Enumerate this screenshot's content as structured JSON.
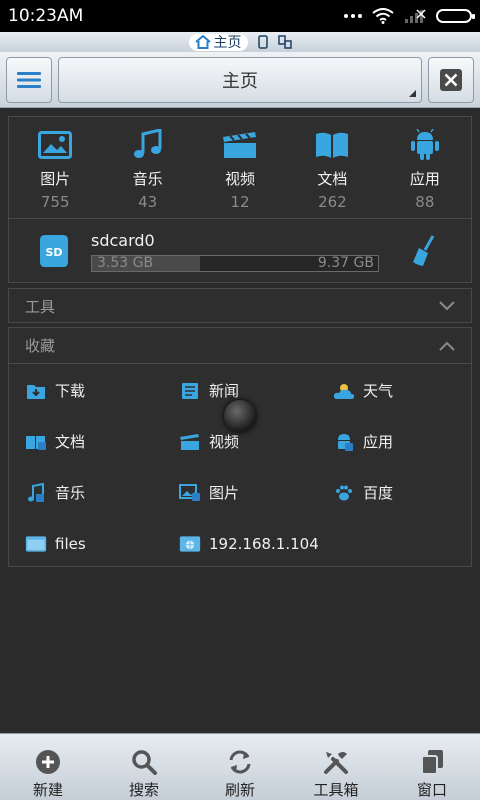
{
  "status": {
    "time": "10:23AM"
  },
  "tabstrip": {
    "home_label": "主页"
  },
  "toolbar": {
    "path": "主页"
  },
  "categories": [
    {
      "label": "图片",
      "count": "755",
      "icon": "image-icon"
    },
    {
      "label": "音乐",
      "count": "43",
      "icon": "music-icon"
    },
    {
      "label": "视频",
      "count": "12",
      "icon": "video-icon"
    },
    {
      "label": "文档",
      "count": "262",
      "icon": "book-icon"
    },
    {
      "label": "应用",
      "count": "88",
      "icon": "android-icon"
    }
  ],
  "storage": {
    "name": "sdcard0",
    "used": "3.53 GB",
    "total": "9.37 GB",
    "used_fraction": 0.377
  },
  "tools": {
    "title": "工具"
  },
  "favorites": {
    "title": "收藏",
    "items": [
      {
        "label": "下载",
        "icon": "download-icon"
      },
      {
        "label": "新闻",
        "icon": "news-icon"
      },
      {
        "label": "天气",
        "icon": "weather-icon"
      },
      {
        "label": "文档",
        "icon": "book-icon"
      },
      {
        "label": "视频",
        "icon": "video-icon"
      },
      {
        "label": "应用",
        "icon": "android-icon"
      },
      {
        "label": "音乐",
        "icon": "music-icon"
      },
      {
        "label": "图片",
        "icon": "image-icon"
      },
      {
        "label": "百度",
        "icon": "baidu-paw-icon"
      },
      {
        "label": "files",
        "icon": "folder-icon"
      },
      {
        "label": "192.168.1.104",
        "icon": "network-folder-icon"
      }
    ]
  },
  "bottom_bar": [
    {
      "label": "新建",
      "icon": "add-icon"
    },
    {
      "label": "搜索",
      "icon": "search-icon"
    },
    {
      "label": "刷新",
      "icon": "refresh-icon"
    },
    {
      "label": "工具箱",
      "icon": "toolbox-icon"
    },
    {
      "label": "窗口",
      "icon": "windows-icon"
    }
  ],
  "colors": {
    "accent": "#3aa6e0",
    "background": "#2b2b2b",
    "panel_border": "#494949"
  }
}
